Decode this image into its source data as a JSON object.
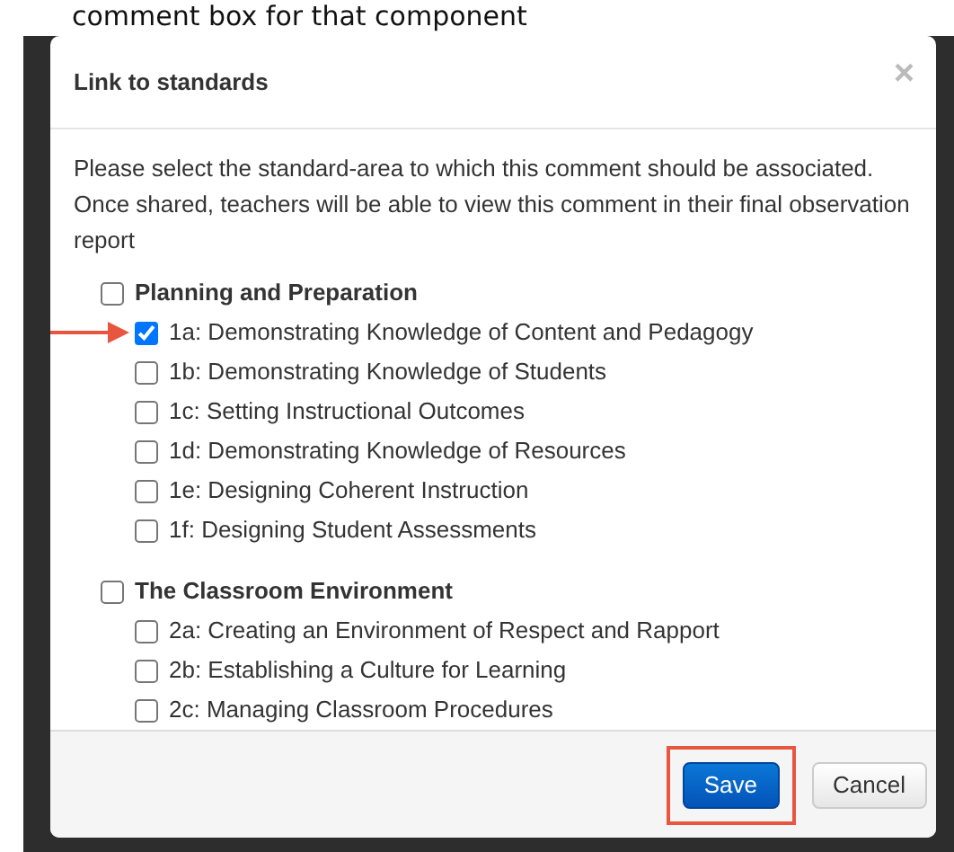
{
  "page_heading": "comment box for that component",
  "modal": {
    "title": "Link to standards",
    "close": "×",
    "intro": "Please select the standard-area to which this comment should be associated. Once shared, teachers will be able to view this comment in their final observation report",
    "groups": [
      {
        "label": "Planning and Preparation",
        "checked": false,
        "children": [
          {
            "label": "1a: Demonstrating Knowledge of Content and Pedagogy",
            "checked": true,
            "arrow": true
          },
          {
            "label": "1b: Demonstrating Knowledge of Students",
            "checked": false,
            "arrow": false
          },
          {
            "label": "1c: Setting Instructional Outcomes",
            "checked": false,
            "arrow": false
          },
          {
            "label": "1d: Demonstrating Knowledge of Resources",
            "checked": false,
            "arrow": false
          },
          {
            "label": "1e: Designing Coherent Instruction",
            "checked": false,
            "arrow": false
          },
          {
            "label": "1f: Designing Student Assessments",
            "checked": false,
            "arrow": false
          }
        ]
      },
      {
        "label": "The Classroom Environment",
        "checked": false,
        "children": [
          {
            "label": "2a: Creating an Environment of Respect and Rapport",
            "checked": false,
            "arrow": false
          },
          {
            "label": "2b: Establishing a Culture for Learning",
            "checked": false,
            "arrow": false
          },
          {
            "label": "2c: Managing Classroom Procedures",
            "checked": false,
            "arrow": false
          }
        ]
      }
    ],
    "buttons": [
      {
        "label": "Save",
        "kind": "primary",
        "highlighted": true
      },
      {
        "label": "Cancel",
        "kind": "default",
        "highlighted": false
      }
    ]
  }
}
